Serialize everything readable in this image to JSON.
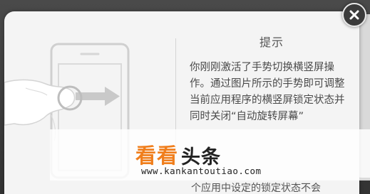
{
  "dialog": {
    "title": "提示",
    "message": "你刚刚激活了手势切换横竖屏操作。通过图片所示的手势即可调整当前应用程序的横竖屏锁定状态并同时关闭“自动旋转屏幕”",
    "partial_line": "个应用中设定的锁定状态不会",
    "close_icon": "close-icon"
  },
  "illustration": {
    "icons": [
      "phone-outline-icon",
      "hand-gesture-icon",
      "arrow-right-icon"
    ]
  },
  "watermark": {
    "brand_orange": "看看",
    "brand_black": "头条",
    "url": "www.kankantoutiao.com"
  },
  "colors": {
    "dialog_bg": "#f4f4f4",
    "watermark_orange": "#f07e1c",
    "close_bg": "#3b3b3b"
  }
}
